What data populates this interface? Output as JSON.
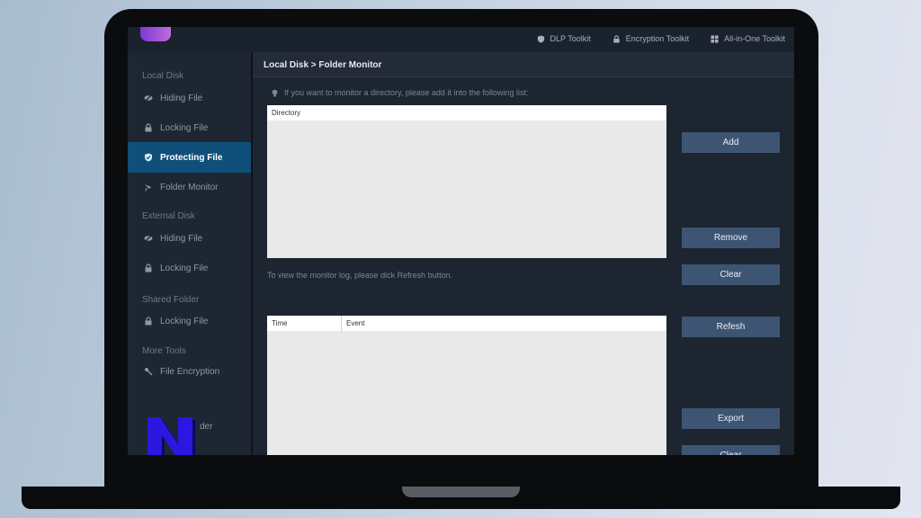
{
  "toolbar": {
    "links": [
      {
        "label": "DLP Toolkit",
        "icon": "shield-icon"
      },
      {
        "label": "Encryption Toolkit",
        "icon": "lock-icon"
      },
      {
        "label": "All-in-One Toolkit",
        "icon": "grid-icon"
      }
    ]
  },
  "sidebar": {
    "sections": {
      "local_disk": "Local Disk",
      "external_disk": "External Disk",
      "shared_folder": "Shared Folder",
      "more_tools": "More Tools"
    },
    "items": {
      "local_hiding": "Hiding File",
      "local_locking": "Locking File",
      "local_protecting": "Protecting File",
      "local_folder_monitor": "Folder Monitor",
      "external_hiding": "Hiding File",
      "external_locking": "Locking File",
      "shared_locking": "Locking File",
      "file_encryption": "File Encryption",
      "partial": "der"
    },
    "active_item": "Protecting File"
  },
  "main": {
    "breadcrumb": "Local Disk > Folder Monitor",
    "hint_top": "If you want to monitor a directory, please add it into the following list:",
    "directory_table": {
      "columns": [
        "Directory"
      ]
    },
    "hint_log": "To view the monitor log, please dick Refresh button.",
    "log_table": {
      "columns": [
        "Time",
        "Event"
      ]
    },
    "buttons": {
      "add": "Add",
      "remove": "Remove",
      "clear_top": "Clear",
      "refresh": "Refesh",
      "export": "Export",
      "clear_bottom": "Clear"
    }
  },
  "colors": {
    "accent_active": "#0f4f79",
    "button": "#3d5573",
    "sidebar_bg": "#1d2632",
    "watermark": "#2a17e0"
  },
  "watermark": {
    "icon": "n-logo-icon"
  }
}
